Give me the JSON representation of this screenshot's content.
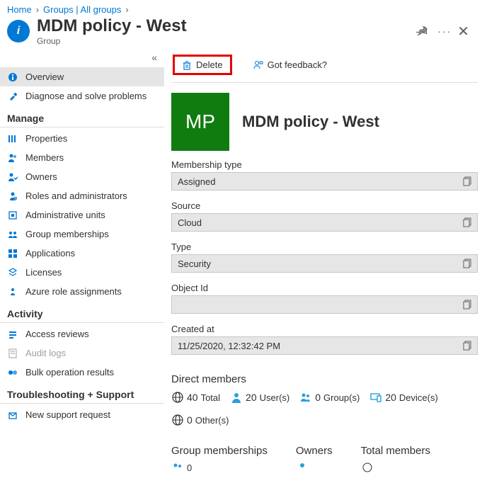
{
  "breadcrumb": [
    {
      "label": "Home"
    },
    {
      "label": "Groups | All groups"
    }
  ],
  "page": {
    "title": "MDM policy - West",
    "subtitle": "Group"
  },
  "nav": {
    "overview": "Overview",
    "diagnose": "Diagnose and solve problems",
    "section_manage": "Manage",
    "properties": "Properties",
    "members": "Members",
    "owners": "Owners",
    "roles": "Roles and administrators",
    "admin_units": "Administrative units",
    "group_memberships": "Group memberships",
    "applications": "Applications",
    "licenses": "Licenses",
    "azure_role": "Azure role assignments",
    "section_activity": "Activity",
    "access_reviews": "Access reviews",
    "audit_logs": "Audit logs",
    "bulk_results": "Bulk operation results",
    "section_trouble": "Troubleshooting + Support",
    "new_support": "New support request"
  },
  "commands": {
    "delete": "Delete",
    "feedback": "Got feedback?"
  },
  "hero": {
    "initials": "MP",
    "name": "MDM policy - West"
  },
  "fields": {
    "membership_type": {
      "label": "Membership type",
      "value": "Assigned"
    },
    "source": {
      "label": "Source",
      "value": "Cloud"
    },
    "type": {
      "label": "Type",
      "value": "Security"
    },
    "object_id": {
      "label": "Object Id",
      "value": ""
    },
    "created_at": {
      "label": "Created at",
      "value": "11/25/2020, 12:32:42 PM"
    }
  },
  "direct_members": {
    "title": "Direct members",
    "total": {
      "value": "40",
      "label": "Total"
    },
    "users": {
      "value": "20",
      "label": "User(s)"
    },
    "groups": {
      "value": "0",
      "label": "Group(s)"
    },
    "devices": {
      "value": "20",
      "label": "Device(s)"
    },
    "others": {
      "value": "0",
      "label": "Other(s)"
    }
  },
  "summary": {
    "group_memberships": {
      "title": "Group memberships",
      "value": "0"
    },
    "owners": {
      "title": "Owners"
    },
    "total_members": {
      "title": "Total members"
    }
  }
}
